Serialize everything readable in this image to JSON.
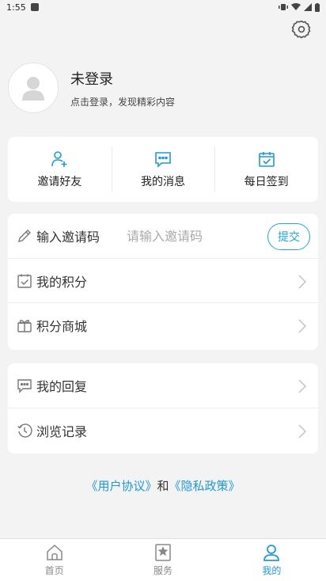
{
  "status_bar": {
    "time": "1:55"
  },
  "profile": {
    "name": "未登录",
    "subtitle": "点击登录，发现精彩内容"
  },
  "quick_actions": [
    {
      "label": "邀请好友",
      "icon": "invite-friend-icon"
    },
    {
      "label": "我的消息",
      "icon": "message-icon"
    },
    {
      "label": "每日签到",
      "icon": "calendar-check-icon"
    }
  ],
  "invite": {
    "label": "输入邀请码",
    "placeholder": "请输入邀请码",
    "submit_label": "提交"
  },
  "menu_group1": [
    {
      "label": "我的积分",
      "icon": "points-icon"
    },
    {
      "label": "积分商城",
      "icon": "gift-icon"
    }
  ],
  "menu_group2": [
    {
      "label": "我的回复",
      "icon": "comment-icon"
    },
    {
      "label": "浏览记录",
      "icon": "history-icon"
    }
  ],
  "agreement": {
    "user_agreement": "《用户协议》",
    "and": "和",
    "privacy_policy": "《隐私政策》"
  },
  "tabs": [
    {
      "label": "首页",
      "icon": "home-icon",
      "active": false
    },
    {
      "label": "服务",
      "icon": "service-icon",
      "active": false
    },
    {
      "label": "我的",
      "icon": "profile-icon",
      "active": true
    }
  ],
  "colors": {
    "accent": "#1e9ad6",
    "background": "#f3f3f3"
  }
}
